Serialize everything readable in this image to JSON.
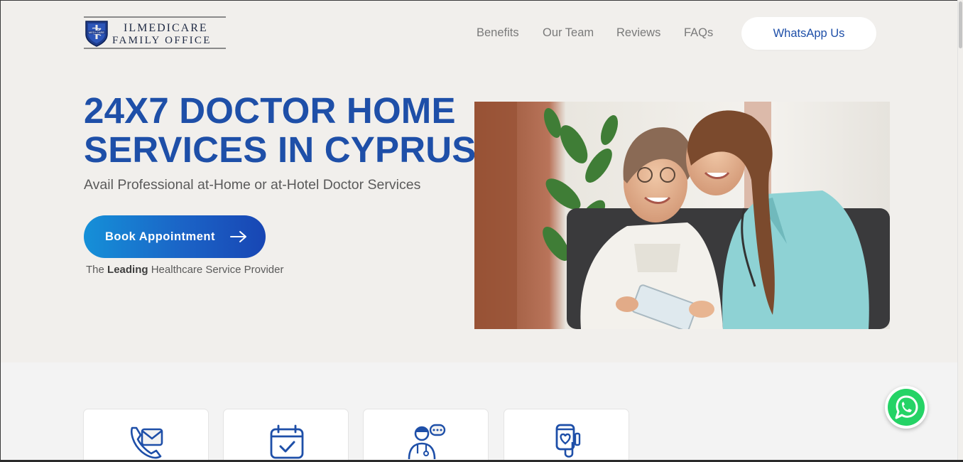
{
  "brand": {
    "name_line1": "ILMEDICARE",
    "name_line2": "FAMILY OFFICE",
    "emblem_icon": "medical-shield-icon",
    "emblem_text": "MEDI CARE"
  },
  "nav": {
    "items": [
      {
        "label": "Benefits"
      },
      {
        "label": "Our Team"
      },
      {
        "label": "Reviews"
      },
      {
        "label": "FAQs"
      }
    ],
    "cta_label": "WhatsApp Us"
  },
  "hero": {
    "title_line1": "24X7 DOCTOR HOME",
    "title_line2": "SERVICES IN CYPRUS",
    "subtitle": "Avail Professional at-Home or at-Hotel Doctor Services",
    "button_label": "Book Appointment",
    "button_icon": "arrow-right-icon",
    "tagline_prefix": "The",
    "tagline_bold": "Leading",
    "tagline_suffix": "Healthcare Service Provider",
    "photo": "nurse-with-elderly-woman-photo"
  },
  "services": [
    {
      "icon": "phone-email-icon"
    },
    {
      "icon": "calendar-check-icon"
    },
    {
      "icon": "doctor-chat-icon"
    },
    {
      "icon": "iv-drip-heart-icon"
    }
  ],
  "floating": {
    "icon": "whatsapp-icon"
  },
  "colors": {
    "primary": "#1e4fa8",
    "hero_bg": "#f1efec",
    "button_gradient_start": "#1590d8",
    "button_gradient_end": "#1846b4",
    "whatsapp_green": "#25d366"
  }
}
